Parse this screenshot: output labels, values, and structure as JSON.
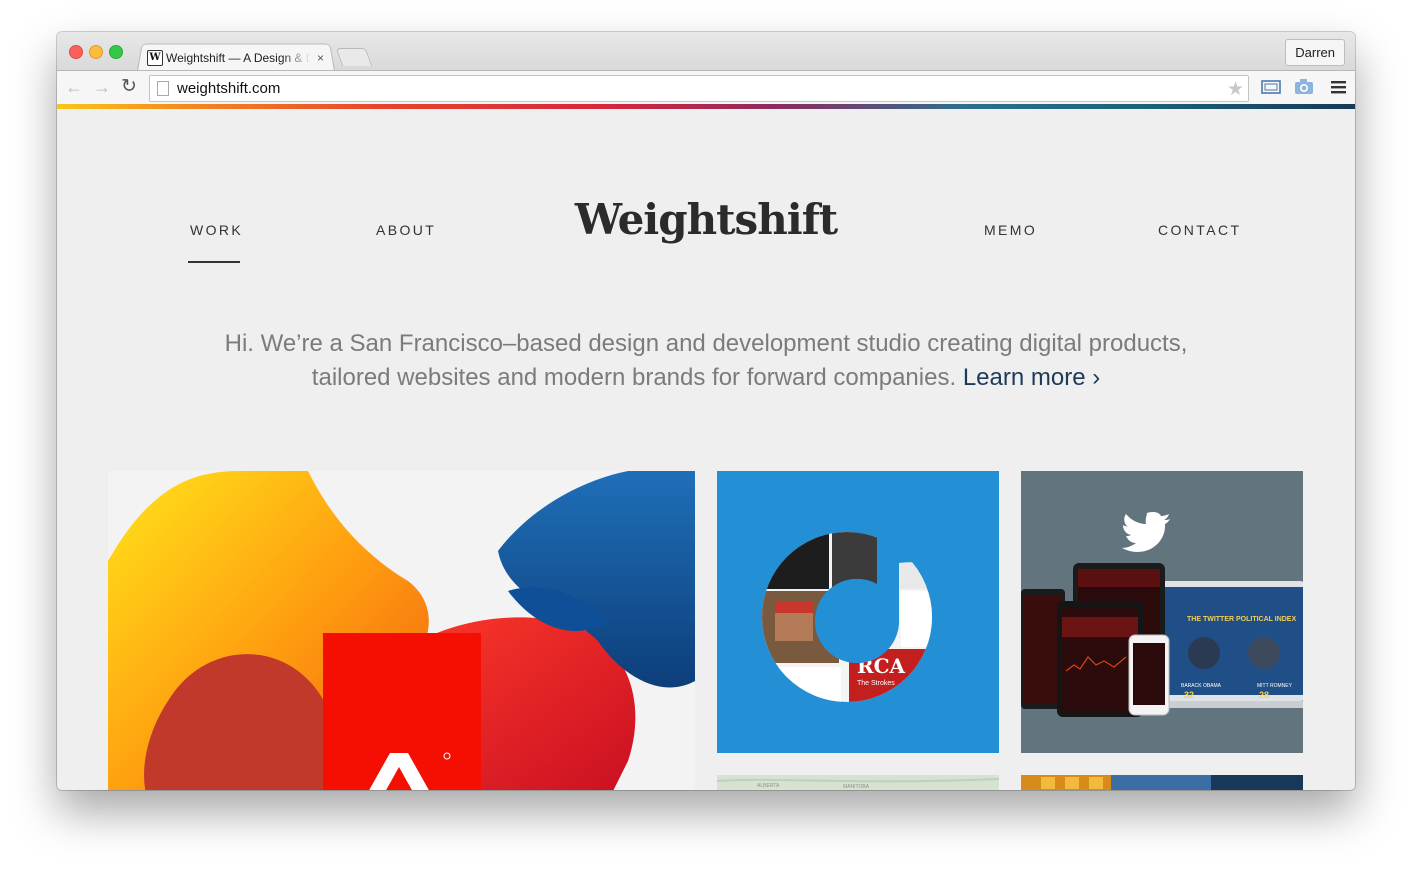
{
  "browser": {
    "tab_title": "Weightshift — A Design & D",
    "tab_close": "×",
    "favicon_letter": "W",
    "profile_name": "Darren",
    "url": "weightshift.com",
    "icons": [
      "back-arrow-icon",
      "forward-arrow-icon",
      "reload-icon",
      "page-icon",
      "bookmark-star-icon",
      "cast-icon",
      "camera-icon",
      "menu-icon"
    ]
  },
  "site": {
    "logo": "Weightshift",
    "nav": {
      "work": "WORK",
      "about": "ABOUT",
      "memo": "MEMO",
      "contact": "CONTACT"
    },
    "active_nav": "WORK",
    "intro_text": "Hi. We’re a San Francisco–based design and development studio creating digital products, tailored websites and modern brands for forward companies.",
    "learn_more": "Learn more ›"
  },
  "tiles": {
    "music": {
      "rca_label": "RCA",
      "rca_sub": "The Strokes"
    },
    "twitter": {
      "headline": "THE TWITTER POLITICAL INDEX",
      "candidate_left": "BARACK OBAMA",
      "score_left": "32",
      "candidate_right": "MITT ROMNEY",
      "score_right": "28"
    },
    "map": {
      "label_1": "ALBERTA",
      "label_2": "MANITOBA"
    }
  },
  "colors": {
    "brand_dark": "#2b2b2b",
    "link": "#1f3a57",
    "intro_text": "#7b7b7b",
    "music_tile_blue": "#2390d6",
    "twitter_tile_slate": "#62757e",
    "adobe_red": "#f40f02"
  }
}
